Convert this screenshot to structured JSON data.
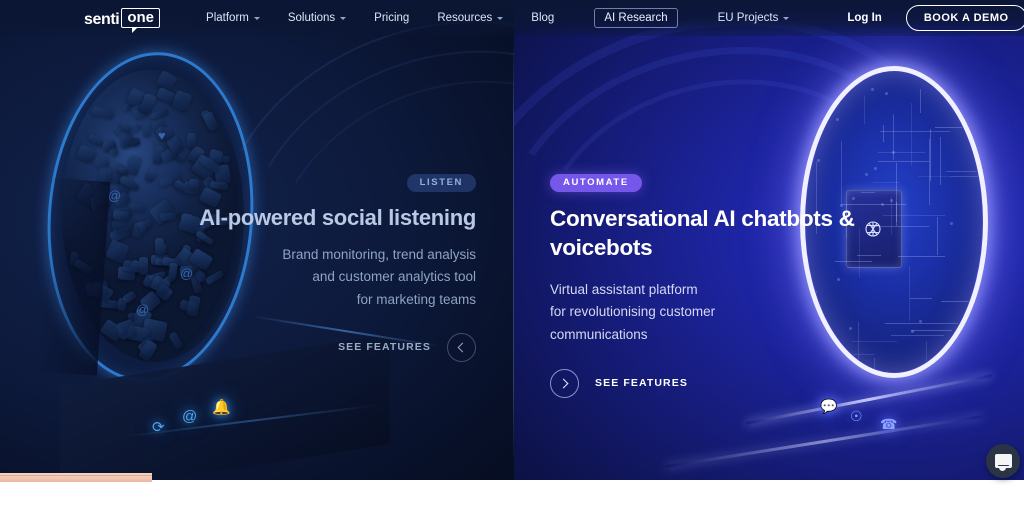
{
  "header": {
    "logo": {
      "part1": "senti",
      "part2": "one"
    },
    "nav": [
      {
        "label": "Platform",
        "has_dropdown": true
      },
      {
        "label": "Solutions",
        "has_dropdown": true
      },
      {
        "label": "Pricing",
        "has_dropdown": false
      },
      {
        "label": "Resources",
        "has_dropdown": true
      },
      {
        "label": "Blog",
        "has_dropdown": false
      }
    ],
    "ai_research_label": "AI Research",
    "eu_projects_label": "EU Projects",
    "login_label": "Log In",
    "demo_label": "BOOK A DEMO"
  },
  "hero": {
    "left": {
      "badge": "LISTEN",
      "title": "AI-powered social listening",
      "subtitle_lines": [
        "Brand monitoring, trend analysis",
        "and customer analytics tool",
        "for marketing teams"
      ],
      "cta_label": "SEE FEATURES",
      "arrow_icon": "chevron-left-icon"
    },
    "right": {
      "badge": "AUTOMATE",
      "title_lines": [
        "Conversational AI chatbots &",
        "voicebots"
      ],
      "subtitle_lines": [
        "Virtual assistant platform",
        "for revolutionising customer",
        "communications"
      ],
      "cta_label": "SEE FEATURES",
      "arrow_icon": "chevron-right-icon"
    }
  },
  "chat_widget": {
    "icon": "chat-bubble-icon"
  },
  "colors": {
    "accent_purple": "#7558ea",
    "accent_blue": "#2f7fd6",
    "left_bg": "#0d1a3c",
    "right_bg": "#1d24a0",
    "text_light": "#ffffff",
    "text_muted": "#8fa3c4",
    "peach_strip": "#f3c7b2"
  }
}
